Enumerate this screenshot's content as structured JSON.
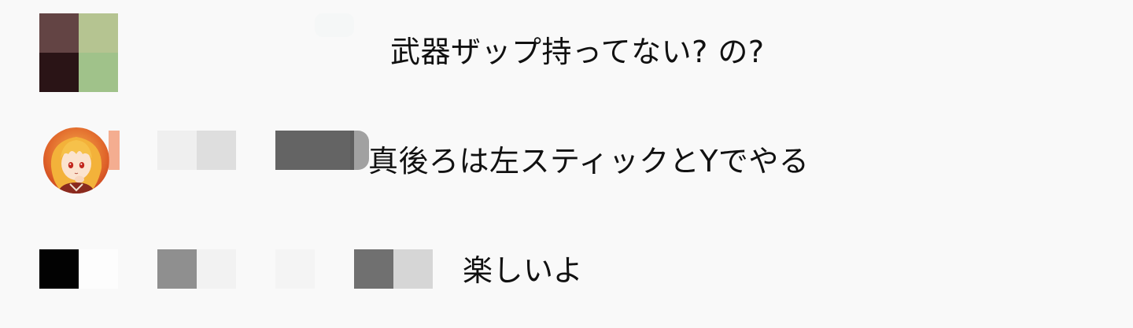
{
  "chat": {
    "messages": [
      {
        "text": "武器ザップ持ってない? の?",
        "avatar": {
          "kind": "mosaic",
          "tiles": [
            "#634444",
            "#b5c491",
            "#2a1416",
            "#a0c28a"
          ]
        }
      },
      {
        "text": "真後ろは左スティックとYでやる",
        "avatar": {
          "kind": "photo",
          "icon": "anime-girl-avatar-icon"
        }
      },
      {
        "text": "楽しいよ",
        "avatar": {
          "kind": "mosaic",
          "tiles": [
            "#020202",
            "#fdfdfd",
            "#020202",
            "#fdfdfd"
          ]
        }
      }
    ]
  },
  "colors": {
    "background": "#f9f9f9",
    "text": "#111111",
    "redaction_light": "#eeeeee",
    "redaction_mid": "#dcdcdc",
    "redaction_dark": "#646464",
    "redaction_gray": "#8f8f8f"
  }
}
